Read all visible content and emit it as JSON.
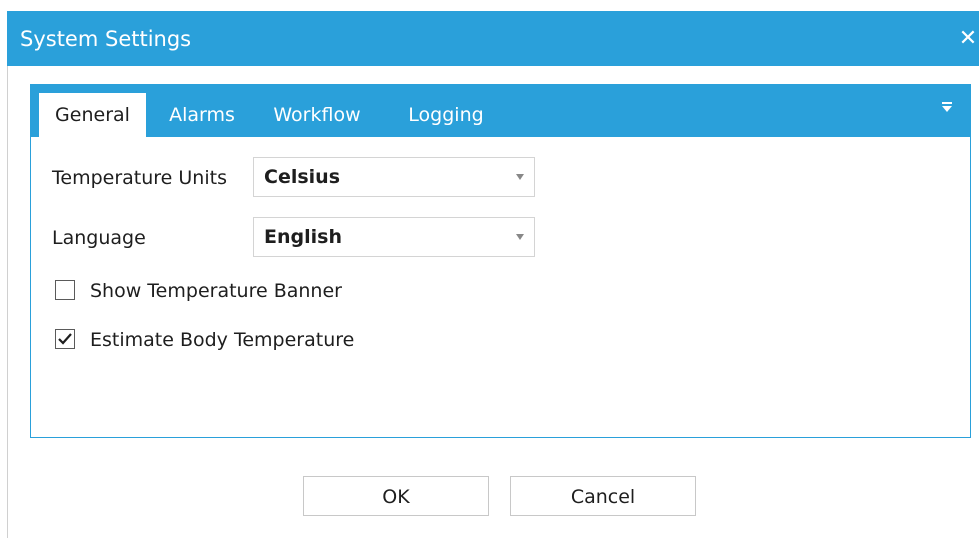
{
  "window": {
    "title": "System Settings",
    "close_glyph": "✕"
  },
  "tabs": [
    {
      "label": "General",
      "active": true
    },
    {
      "label": "Alarms",
      "active": false
    },
    {
      "label": "Workflow",
      "active": false
    },
    {
      "label": "Logging",
      "active": false
    }
  ],
  "tab_overflow_icon": "chevron-down-icon",
  "general": {
    "temperature_units": {
      "label": "Temperature Units",
      "value": "Celsius"
    },
    "language": {
      "label": "Language",
      "value": "English"
    },
    "show_temperature_banner": {
      "label": "Show Temperature Banner",
      "checked": false
    },
    "estimate_body_temperature": {
      "label": "Estimate Body Temperature",
      "checked": true
    }
  },
  "buttons": {
    "ok": "OK",
    "cancel": "Cancel"
  },
  "colors": {
    "accent": "#2aa0da",
    "text": "#1e1e1e",
    "border": "#d4d4d4"
  }
}
